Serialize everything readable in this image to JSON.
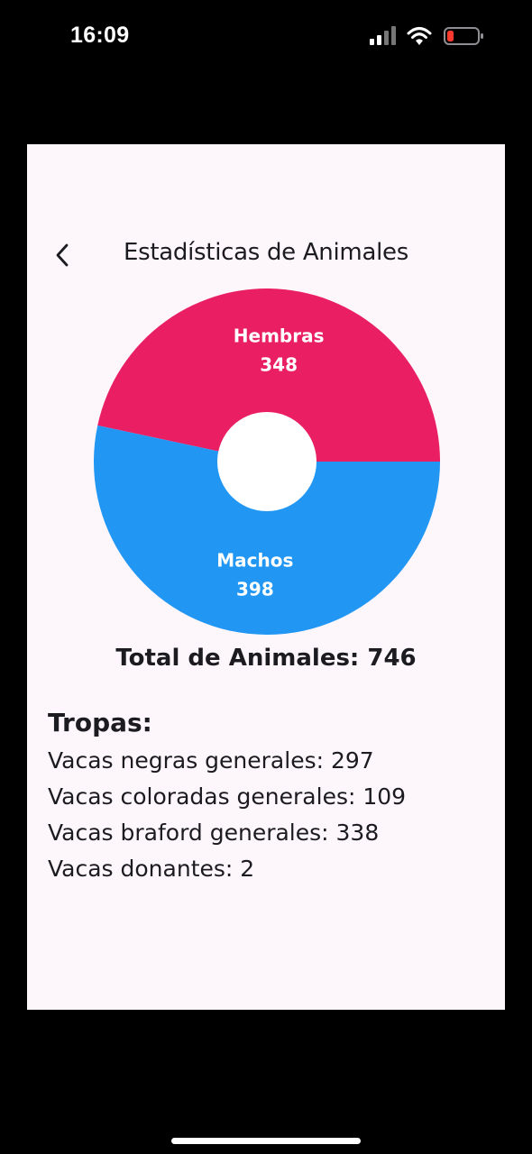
{
  "status_bar": {
    "time": "16:09",
    "battery_color": "#ff3b30"
  },
  "header": {
    "title": "Estadísticas de Animales",
    "back_icon": "chevron-left-icon"
  },
  "chart_data": {
    "type": "pie",
    "variant": "donut",
    "slices": [
      {
        "label": "Hembras",
        "value": 348,
        "color": "#e91e63"
      },
      {
        "label": "Machos",
        "value": 398,
        "color": "#2196f3"
      }
    ]
  },
  "summary": {
    "total_label": "Total de Animales: 746"
  },
  "tropas": {
    "title": "Tropas:",
    "items": [
      {
        "label": "Vacas negras generales: 297"
      },
      {
        "label": "Vacas coloradas generales: 109"
      },
      {
        "label": "Vacas braford generales: 338"
      },
      {
        "label": "Vacas donantes: 2"
      }
    ]
  }
}
